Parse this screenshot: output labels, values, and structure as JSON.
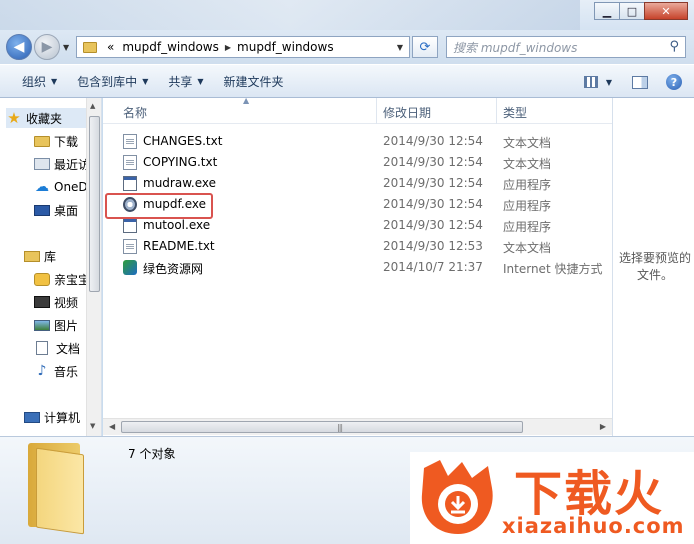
{
  "window": {
    "minimize_glyph": "▁",
    "maximize_glyph": "□",
    "close_glyph": "✕"
  },
  "address": {
    "overflow_glyph": "«",
    "crumbs": [
      "mupdf_windows",
      "mupdf_windows"
    ],
    "search_placeholder": "搜索 mupdf_windows"
  },
  "toolbar": {
    "organize": "组织",
    "include_in_library": "包含到库中",
    "share": "共享",
    "new_folder": "新建文件夹"
  },
  "nav": {
    "items": [
      {
        "label": "收藏夹",
        "icon": "star-icon"
      },
      {
        "label": "下载",
        "icon": "downloads-folder-icon"
      },
      {
        "label": "最近访",
        "icon": "recent-places-icon"
      },
      {
        "label": "OneD",
        "icon": "onedrive-icon"
      },
      {
        "label": "桌面",
        "icon": "desktop-icon"
      },
      {
        "label": "库",
        "icon": "libraries-icon"
      },
      {
        "label": "亲宝宝",
        "icon": "baby-app-icon"
      },
      {
        "label": "视频",
        "icon": "videos-icon"
      },
      {
        "label": "图片",
        "icon": "pictures-icon"
      },
      {
        "label": "文档",
        "icon": "documents-icon"
      },
      {
        "label": "音乐",
        "icon": "music-icon"
      },
      {
        "label": "计算机",
        "icon": "computer-icon"
      }
    ]
  },
  "columns": {
    "name": "名称",
    "date": "修改日期",
    "type": "类型"
  },
  "files": [
    {
      "name": "CHANGES.txt",
      "date": "2014/9/30 12:54",
      "type": "文本文档",
      "icon": "text-file-icon"
    },
    {
      "name": "COPYING.txt",
      "date": "2014/9/30 12:54",
      "type": "文本文档",
      "icon": "text-file-icon"
    },
    {
      "name": "mudraw.exe",
      "date": "2014/9/30 12:54",
      "type": "应用程序",
      "icon": "exe-file-icon"
    },
    {
      "name": "mupdf.exe",
      "date": "2014/9/30 12:54",
      "type": "应用程序",
      "icon": "mupdf-app-icon"
    },
    {
      "name": "mutool.exe",
      "date": "2014/9/30 12:54",
      "type": "应用程序",
      "icon": "exe-file-icon"
    },
    {
      "name": "README.txt",
      "date": "2014/9/30 12:53",
      "type": "文本文档",
      "icon": "text-file-icon"
    },
    {
      "name": "绿色资源网",
      "date": "2014/10/7 21:37",
      "type": "Internet 快捷方式",
      "icon": "internet-shortcut-icon"
    }
  ],
  "preview": {
    "message": "选择要预览的文件。"
  },
  "details": {
    "count": "7 个对象"
  },
  "watermark": {
    "brand": "下载火",
    "url": "xiazaihuo.com",
    "color": "#ef5a21"
  }
}
